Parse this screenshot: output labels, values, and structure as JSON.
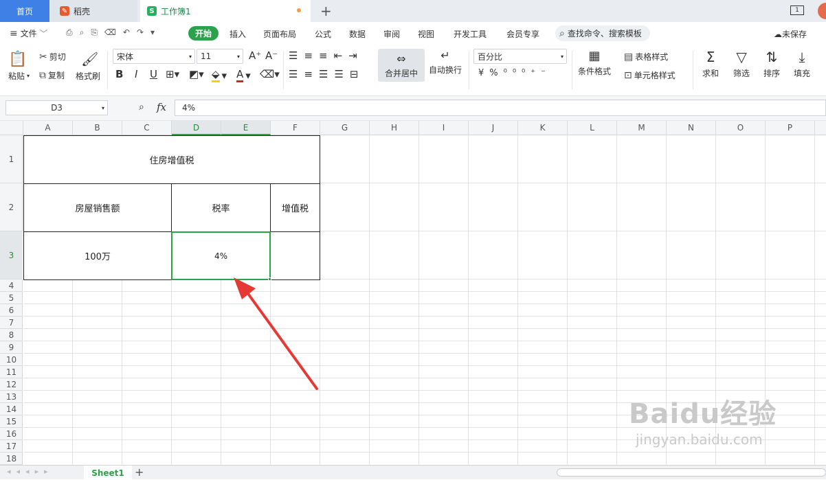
{
  "tabs": {
    "home": "首页",
    "wps": "稻壳",
    "book": "工作簿1"
  },
  "menu": {
    "file": "文件",
    "start": "开始",
    "insert": "插入",
    "page_layout": "页面布局",
    "formula": "公式",
    "data": "数据",
    "review": "审阅",
    "view": "视图",
    "dev_tools": "开发工具",
    "member": "会员专享",
    "search_placeholder": "查找命令、搜索模板",
    "unsaved": "未保存"
  },
  "toolbar": {
    "paste": "粘贴",
    "cut": "剪切",
    "copy": "复制",
    "format_painter": "格式刷",
    "font": "宋体",
    "font_size": "11",
    "merge_center": "合并居中",
    "wrap_text": "自动换行",
    "number_format": "百分比",
    "conditional_format": "条件格式",
    "table_style": "表格样式",
    "cell_style": "单元格样式",
    "sum": "求和",
    "filter": "筛选",
    "sort": "排序",
    "fill": "填充"
  },
  "formula_bar": {
    "cell_ref": "D3",
    "fx": "fx",
    "value": "4%"
  },
  "columns": [
    "A",
    "B",
    "C",
    "D",
    "E",
    "F",
    "G",
    "H",
    "I",
    "J",
    "K",
    "L",
    "M",
    "N",
    "O",
    "P"
  ],
  "rows": [
    "1",
    "2",
    "3",
    "4",
    "5",
    "6",
    "7",
    "8",
    "9",
    "10",
    "11",
    "12",
    "13",
    "14",
    "15",
    "16",
    "17",
    "18"
  ],
  "cells": {
    "title": "住房增值税",
    "sales_header": "房屋销售额",
    "rate_header": "税率",
    "vat_header": "增值税",
    "sales_value": "100万",
    "rate_value": "4%",
    "vat_value": ""
  },
  "sheet": {
    "name": "Sheet1"
  },
  "watermark": {
    "brand": "Baidu经验",
    "url": "jingyan.baidu.com"
  },
  "colors": {
    "accent": "#27a544",
    "arrow": "#e53935",
    "home_tab": "#3e80e6"
  }
}
